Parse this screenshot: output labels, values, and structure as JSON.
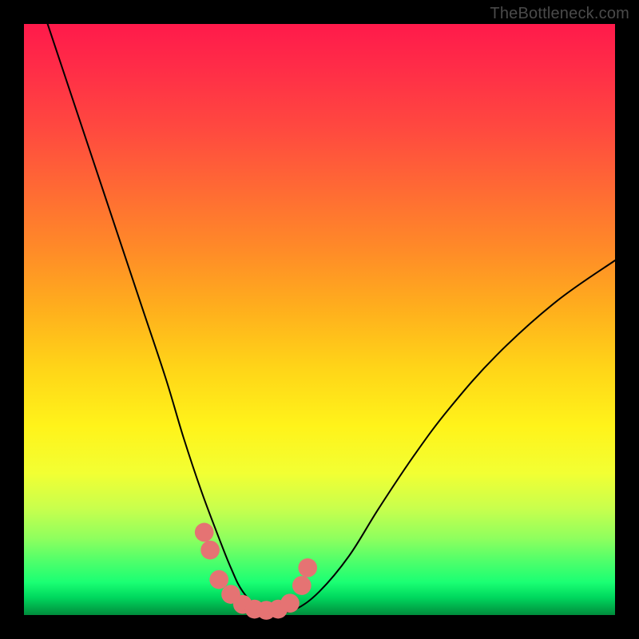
{
  "watermark": "TheBottleneck.com",
  "chart_data": {
    "type": "line",
    "title": "",
    "xlabel": "",
    "ylabel": "",
    "xlim": [
      0,
      100
    ],
    "ylim": [
      0,
      100
    ],
    "series": [
      {
        "name": "curve",
        "x": [
          4,
          8,
          12,
          16,
          20,
          24,
          27,
          30,
          33,
          35,
          37,
          40,
          43,
          46,
          50,
          55,
          60,
          66,
          72,
          80,
          90,
          100
        ],
        "values": [
          100,
          88,
          76,
          64,
          52,
          40,
          30,
          21,
          13,
          8,
          4,
          1,
          0.5,
          1,
          4,
          10,
          18,
          27,
          35,
          44,
          53,
          60
        ]
      }
    ],
    "markers": {
      "color": "#e57373",
      "radius": 1.6,
      "points_x": [
        30.5,
        31.5,
        33,
        35,
        37,
        39,
        41,
        43,
        45,
        47,
        48
      ],
      "points_y": [
        14,
        11,
        6,
        3.5,
        1.8,
        1,
        0.8,
        1,
        2,
        5,
        8
      ]
    }
  }
}
